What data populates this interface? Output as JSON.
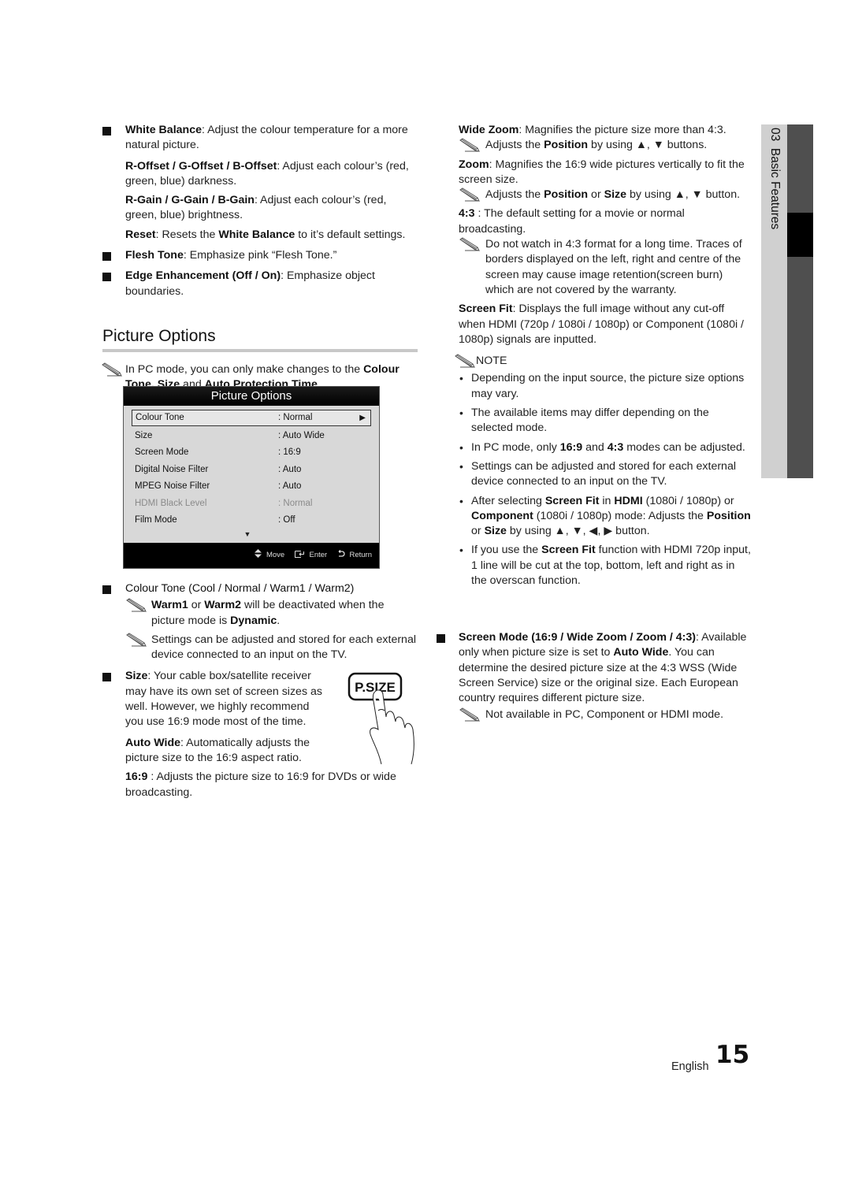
{
  "left_column": {
    "white_balance": {
      "term": "White Balance",
      "text": ": Adjust the colour temperature for a more natural picture."
    },
    "offset": {
      "term": "R-Offset / G-Offset / B-Offset",
      "text": ": Adjust each colour’s (red, green, blue) darkness."
    },
    "gain": {
      "term": "R-Gain / G-Gain / B-Gain",
      "text": ": Adjust each colour’s (red, green, blue) brightness."
    },
    "reset": {
      "term": "Reset",
      "text1": ": Resets the ",
      "term2": "White Balance",
      "text2": " to it’s default settings."
    },
    "flesh_tone": {
      "term": "Flesh Tone",
      "text": ": Emphasize pink “Flesh Tone.”"
    },
    "edge": {
      "term": "Edge Enhancement (Off / On)",
      "text": ": Emphasize object boundaries."
    },
    "section_title": "Picture Options",
    "pc_note": {
      "text1": "In PC mode, you can only make changes to the ",
      "t1": "Colour Tone, Size",
      "text2": " and ",
      "t2": "Auto Protection Time",
      "text3": "."
    },
    "colour_tone": {
      "term": "Colour Tone (Cool / Normal / Warm1 / Warm2)"
    },
    "colour_note1": {
      "t1": "Warm1",
      "text1": " or ",
      "t2": "Warm2",
      "text2": " will be deactivated when the picture mode is ",
      "t3": "Dynamic",
      "text3": "."
    },
    "colour_note2": "Settings can be adjusted and stored for each external device connected to an input on the TV.",
    "size": {
      "term": "Size",
      "text": ": Your cable box/satellite receiver may have its own set of screen sizes as well. However, we highly recommend you use 16:9 mode most of the time."
    },
    "auto_wide": {
      "term": "Auto Wide",
      "text": ": Automatically adjusts the picture size to the 16:9 aspect ratio."
    },
    "ratio_169": {
      "term": "16:9",
      "text": " : Adjusts the picture size to 16:9 for DVDs or wide broadcasting."
    },
    "psize_button": "P.SIZE"
  },
  "osd": {
    "title": "Picture Options",
    "rows": [
      {
        "label": "Colour Tone",
        "value": ": Normal",
        "selected": true
      },
      {
        "label": "Size",
        "value": ": Auto Wide"
      },
      {
        "label": "Screen Mode",
        "value": ": 16:9"
      },
      {
        "label": "Digital Noise Filter",
        "value": ": Auto"
      },
      {
        "label": "MPEG Noise Filter",
        "value": ": Auto"
      },
      {
        "label": "HDMI Black Level",
        "value": ": Normal",
        "disabled": true
      },
      {
        "label": "Film Mode",
        "value": ": Off"
      }
    ],
    "more_arrow": "▼",
    "selected_arrow": "▶",
    "footer": {
      "move": "Move",
      "enter": "Enter",
      "return": "Return"
    }
  },
  "right_column": {
    "wide_zoom": {
      "term": "Wide Zoom",
      "text": ": Magnifies the picture size more than 4:3."
    },
    "wide_zoom_note": {
      "text1": "Adjusts the ",
      "t1": "Position",
      "text2": " by using ▲, ▼ buttons."
    },
    "zoom": {
      "term": "Zoom",
      "text": ": Magnifies the 16:9 wide pictures vertically to fit the screen size."
    },
    "zoom_note": {
      "text1": "Adjusts the ",
      "t1": "Position",
      "text2": " or ",
      "t2": "Size",
      "text3": " by using ▲, ▼ button."
    },
    "ratio_43": {
      "term": "4:3",
      "text": " : The default setting for a movie or normal broadcasting."
    },
    "ratio_43_note": "Do not watch in 4:3 format for a long time. Traces of borders displayed on the left, right and centre of the screen may cause image retention(screen burn) which are not covered by the warranty.",
    "screen_fit": {
      "term": "Screen Fit",
      "text": ": Displays the full image without any cut-off when HDMI (720p / 1080i / 1080p) or Component (1080i / 1080p) signals are inputted."
    },
    "note_label": "NOTE",
    "notes": [
      {
        "text": "Depending on the input source, the picture size options may vary."
      },
      {
        "text": "The available items may differ depending on the selected mode."
      },
      {
        "text1": "In PC mode, only ",
        "t1": "16:9",
        "text2": " and ",
        "t2": "4:3",
        "text3": " modes can be adjusted."
      },
      {
        "text": "Settings can be adjusted and stored for each external device connected to an input on the TV."
      },
      {
        "text1": "After selecting ",
        "t1": "Screen Fit",
        "text2": " in ",
        "t2": "HDMI",
        "text3": " (1080i / 1080p) or ",
        "t3": "Component",
        "text4": " (1080i / 1080p) mode: Adjusts the ",
        "t4": "Position",
        "text5": " or ",
        "t5": "Size",
        "text6": " by using ▲, ▼, ◀, ▶ button."
      },
      {
        "text1": "If you use the ",
        "t1": "Screen Fit",
        "text2": " function with HDMI 720p input, 1 line will be cut at the top, bottom, left and right as in the overscan function."
      }
    ],
    "screen_mode": {
      "term": "Screen Mode (16:9 / Wide Zoom / Zoom / 4:3)",
      "text1": ": Available only when picture size is set to ",
      "t1": "Auto Wide",
      "text2": ". You can determine the desired picture size at the 4:3 WSS (Wide Screen Service) size or the original size. Each European country requires different picture size."
    },
    "screen_mode_note": "Not available in PC, Component or HDMI mode."
  },
  "side_tab": {
    "chapter": "03",
    "title": "Basic Features"
  },
  "footer": {
    "language": "English",
    "page_number": "15"
  }
}
